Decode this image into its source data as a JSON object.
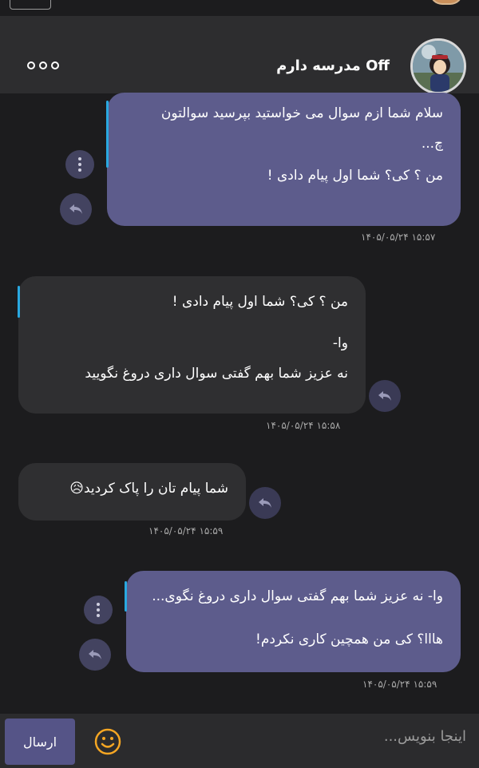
{
  "header": {
    "title": "Off مدرسه دارم",
    "more_icon": "more-dots-icon",
    "avatar_icon": "profile-avatar"
  },
  "messages": [
    {
      "direction": "incoming",
      "lines": [
        "سلام شما ازم سوال می خواستید بپرسید سوالتون",
        "چ...",
        "",
        "من ؟ کی؟ شما اول پیام دادی !"
      ],
      "time": "۱۴۰۵/۰۵/۲۴ ۱۵:۵۷"
    },
    {
      "direction": "outgoing",
      "lines": [
        "من ؟ کی؟ شما اول پیام دادی !",
        "",
        "وا-",
        "نه عزیز شما بهم گفتی سوال داری دروغ نگویید"
      ],
      "time": "۱۴۰۵/۰۵/۲۴ ۱۵:۵۸"
    },
    {
      "direction": "outgoing",
      "lines": [
        "شما پیام تان را پاک کردید😥"
      ],
      "time": "۱۴۰۵/۰۵/۲۴ ۱۵:۵۹"
    },
    {
      "direction": "incoming",
      "lines": [
        "وا- نه عزیز شما بهم گفتی سوال داری دروغ نگوی...",
        "",
        "هااا؟ کی من همچین کاری نکردم!"
      ],
      "time": "۱۴۰۵/۰۵/۲۴ ۱۵:۵۹"
    }
  ],
  "composer": {
    "placeholder": "اینجا بنویس...",
    "send_label": "ارسال",
    "emoji_icon": "smiley-icon"
  },
  "colors": {
    "incoming_bubble": "#5d5c8c",
    "outgoing_bubble": "#2f2f31",
    "quote_bar": "#29a8e0",
    "emoji": "#f5a623"
  }
}
